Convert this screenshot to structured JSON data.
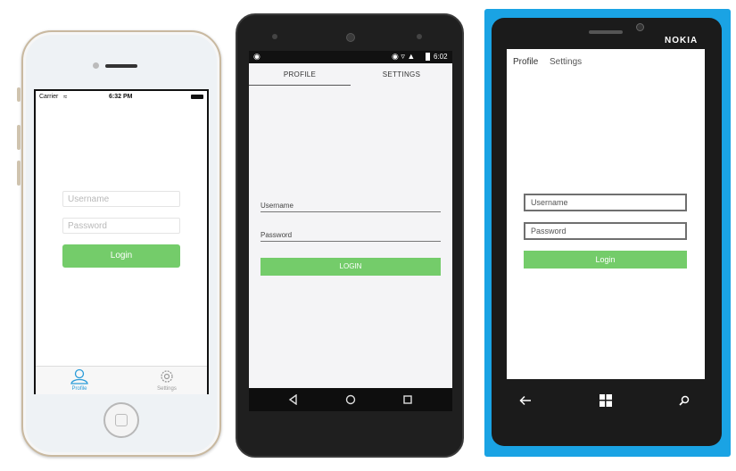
{
  "iphone": {
    "status": {
      "carrier": "Carrier",
      "time": "6:32 PM"
    },
    "form": {
      "username_placeholder": "Username",
      "password_placeholder": "Password",
      "login_label": "Login"
    },
    "tabs": [
      {
        "label": "Profile",
        "icon": "person-icon",
        "active": true
      },
      {
        "label": "Settings",
        "icon": "gear-icon",
        "active": false
      }
    ]
  },
  "android": {
    "status": {
      "time": "6:02"
    },
    "tabs": [
      {
        "label": "PROFILE",
        "active": true
      },
      {
        "label": "SETTINGS",
        "active": false
      }
    ],
    "form": {
      "username_label": "Username",
      "password_label": "Password",
      "login_label": "LOGIN"
    }
  },
  "lumia": {
    "brand": "NOKIA",
    "tabs": [
      {
        "label": "Profile",
        "active": true
      },
      {
        "label": "Settings",
        "active": false
      }
    ],
    "form": {
      "username_placeholder": "Username",
      "password_placeholder": "Password",
      "login_label": "Login"
    }
  },
  "colors": {
    "accent_green": "#74cc6a",
    "ios_active_tab": "#2a9bd8",
    "lumia_frame": "#1aa3e4"
  }
}
